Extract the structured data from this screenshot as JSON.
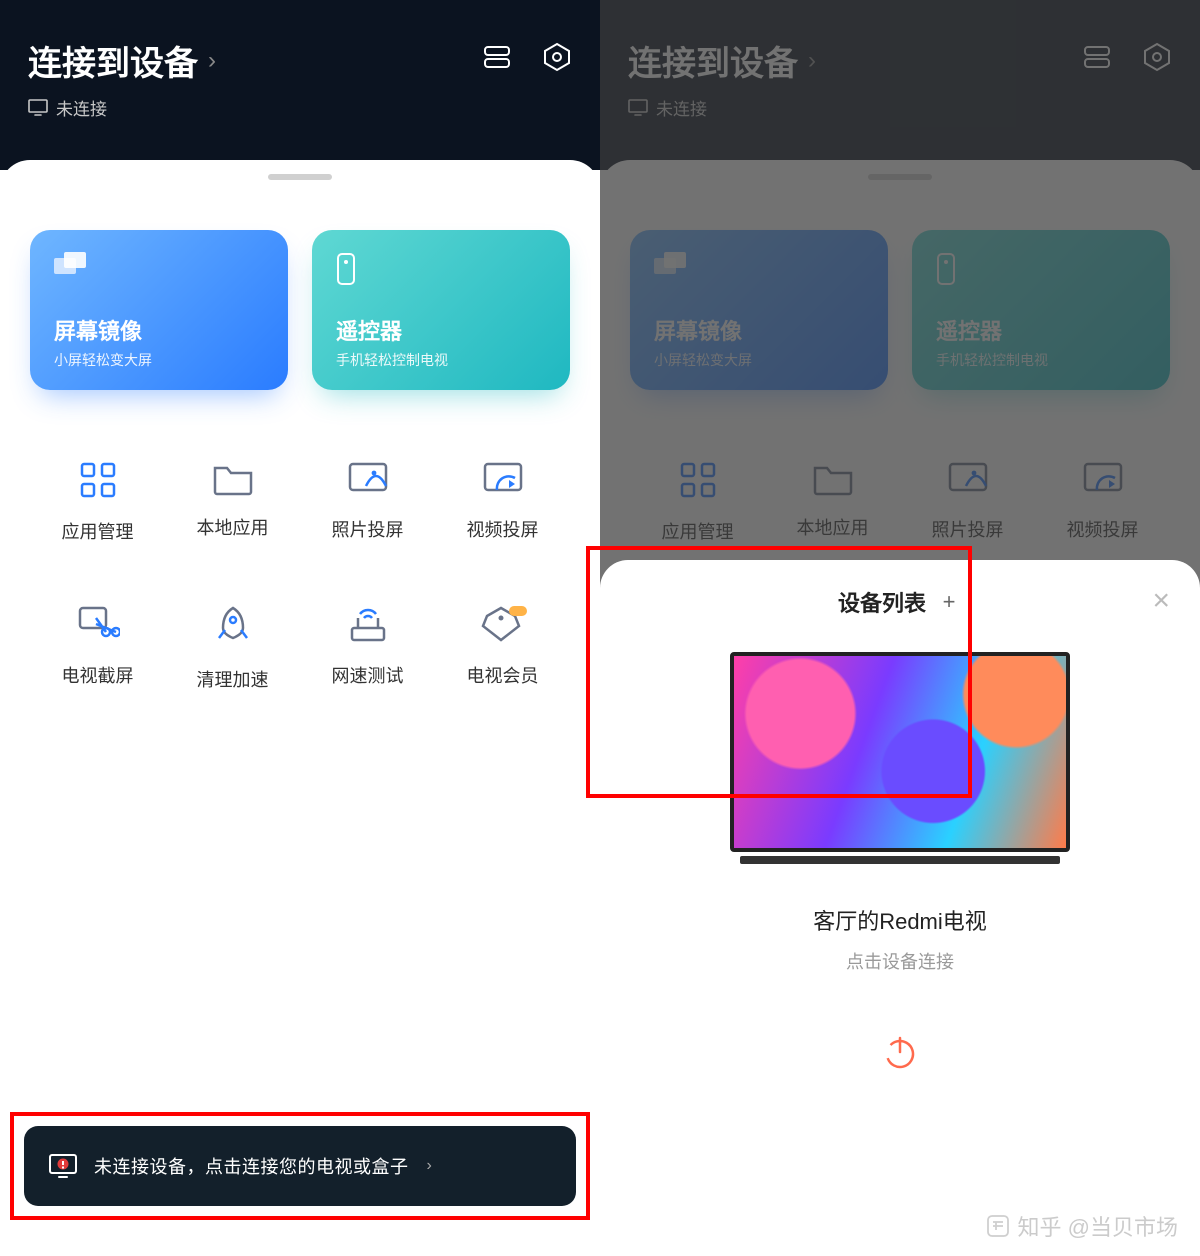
{
  "header": {
    "title": "连接到设备",
    "status": "未连接"
  },
  "cards": {
    "mirror": {
      "title": "屏幕镜像",
      "sub": "小屏轻松变大屏"
    },
    "remote": {
      "title": "遥控器",
      "sub": "手机轻松控制电视"
    }
  },
  "grid": [
    {
      "label": "应用管理"
    },
    {
      "label": "本地应用"
    },
    {
      "label": "照片投屏"
    },
    {
      "label": "视频投屏"
    },
    {
      "label": "电视截屏"
    },
    {
      "label": "清理加速"
    },
    {
      "label": "网速测试"
    },
    {
      "label": "电视会员"
    }
  ],
  "banner": {
    "text": "未连接设备，点击连接您的电视或盒子"
  },
  "popup": {
    "title": "设备列表",
    "device_name": "客厅的Redmi电视",
    "hint": "点击设备连接"
  },
  "watermark": "知乎 @当贝市场"
}
